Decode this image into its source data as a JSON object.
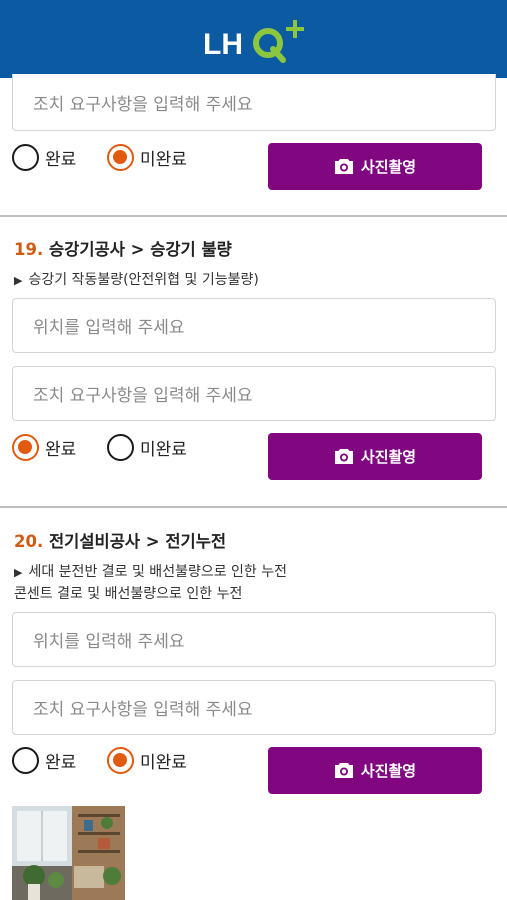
{
  "header": {
    "logo": "LHQ+",
    "bg_color": "#0b5aa2"
  },
  "accent": {
    "radio_selected": "#e05a10",
    "button": "#80077f",
    "number": "#d15a12"
  },
  "item18": {
    "action_placeholder": "조치 요구사항을 입력해 주세요",
    "done_label": "완료",
    "not_done_label": "미완료",
    "selected": "미완료",
    "photo_label": "사진촬영"
  },
  "item19": {
    "number": "19.",
    "title": "승강기공사 > 승강기 불량",
    "desc": "승강기 작동불량(안전위협 및 기능불량)",
    "location_placeholder": "위치를 입력해 주세요",
    "action_placeholder": "조치 요구사항을 입력해 주세요",
    "done_label": "완료",
    "not_done_label": "미완료",
    "selected": "완료",
    "photo_label": "사진촬영"
  },
  "item20": {
    "number": "20.",
    "title": "전기설비공사 > 전기누전",
    "desc_line1": "세대 분전반 결로 및 배선불량으로 인한 누전",
    "desc_line2": "콘센트 결로 및 배선불량으로 인한 누전",
    "location_placeholder": "위치를 입력해 주세요",
    "action_placeholder": "조치 요구사항을 입력해 주세요",
    "done_label": "완료",
    "not_done_label": "미완료",
    "selected": "미완료",
    "photo_label": "사진촬영"
  }
}
